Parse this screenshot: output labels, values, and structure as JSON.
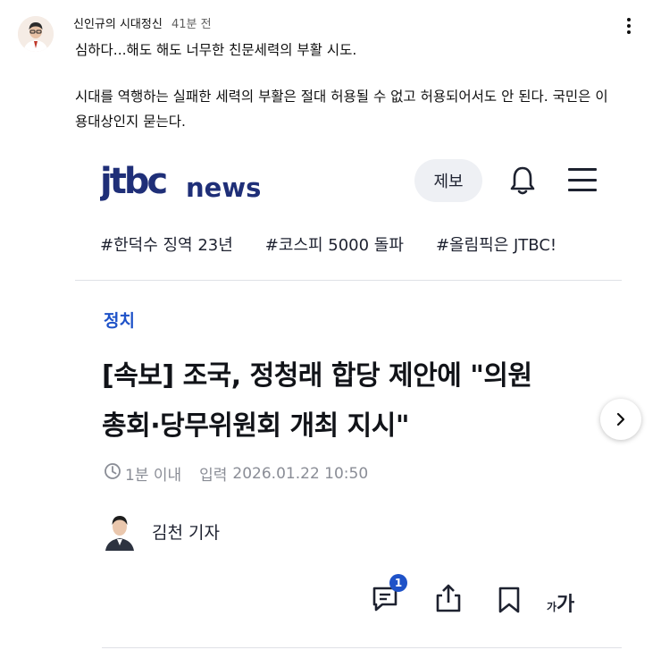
{
  "post": {
    "author": "신인규의 시대정신",
    "time": "41분 전",
    "text_line1": "심하다...해도 해도 너무한 친문세력의 부활 시도.",
    "text_para2": "시대를 역행하는 실패한 세력의 부활은 절대 허용될 수 없고 허용되어서도 안 된다. 국민은 이용대상인지 묻는다."
  },
  "article": {
    "logo_brand": "jtbc",
    "logo_news": "news",
    "report_button": "제보",
    "hashtags": [
      "#한덕수 징역 23년",
      "#코스피 5000 돌파",
      "#올림픽은 JTBC!"
    ],
    "section": "정치",
    "headline_line1": "[속보] 조국, 정청래 합당 제안에 \"의원",
    "headline_line2": "총회·당무위원회 개최 지시\"",
    "time_ago": "1분 이내",
    "input_label": "입력",
    "input_datetime": "2026.01.22 10:50",
    "reporter": "김천 기자",
    "comment_count": "1",
    "font_small": "가",
    "font_big": "가"
  },
  "colors": {
    "brand_blue": "#1e52c8",
    "logo_navy": "#1f2f78",
    "text_dark": "#1e2230",
    "muted": "#8a8d96"
  },
  "icons": [
    "more-vert-icon",
    "bell-icon",
    "hamburger-menu-icon",
    "clock-icon",
    "chevron-right-icon",
    "comment-icon",
    "share-icon",
    "bookmark-icon",
    "font-size-icon"
  ]
}
